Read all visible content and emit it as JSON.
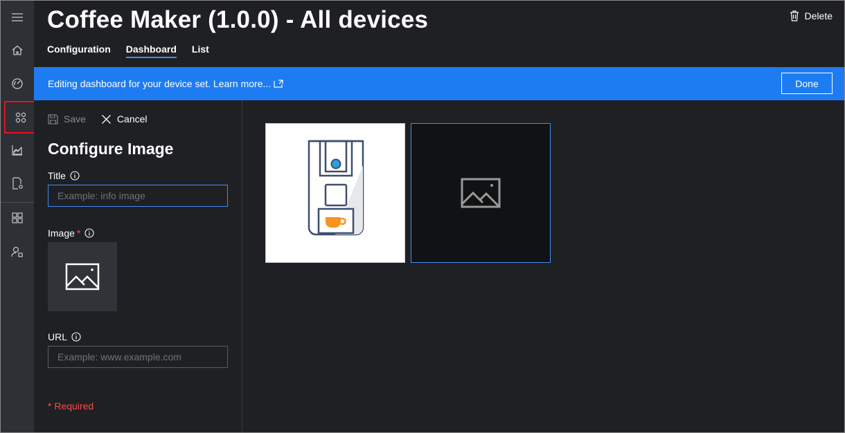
{
  "header": {
    "title": "Coffee Maker (1.0.0) - All devices",
    "tabs": [
      {
        "label": "Configuration",
        "selected": false
      },
      {
        "label": "Dashboard",
        "selected": true
      },
      {
        "label": "List",
        "selected": false
      }
    ],
    "delete_label": "Delete"
  },
  "banner": {
    "text": "Editing dashboard for your device set. Learn more...",
    "done_label": "Done",
    "color": "#1e7cf2"
  },
  "rail": {
    "items": [
      "menu-icon",
      "home-icon",
      "dashboard-icon",
      "device-templates-icon",
      "analytics-icon",
      "jobs-icon",
      "app-builder-icon",
      "administration-icon"
    ],
    "active": "device-templates-icon"
  },
  "panel": {
    "save_label": "Save",
    "cancel_label": "Cancel",
    "title": "Configure Image",
    "title_field": {
      "label": "Title",
      "placeholder": "Example: info image",
      "value": ""
    },
    "image_field": {
      "label": "Image",
      "required_mark": "*"
    },
    "url_field": {
      "label": "URL",
      "placeholder": "Example: www.example.com",
      "value": ""
    },
    "required_note": "* Required"
  },
  "accent_color": "#3e8ef7",
  "required_color": "#ff4a4a"
}
